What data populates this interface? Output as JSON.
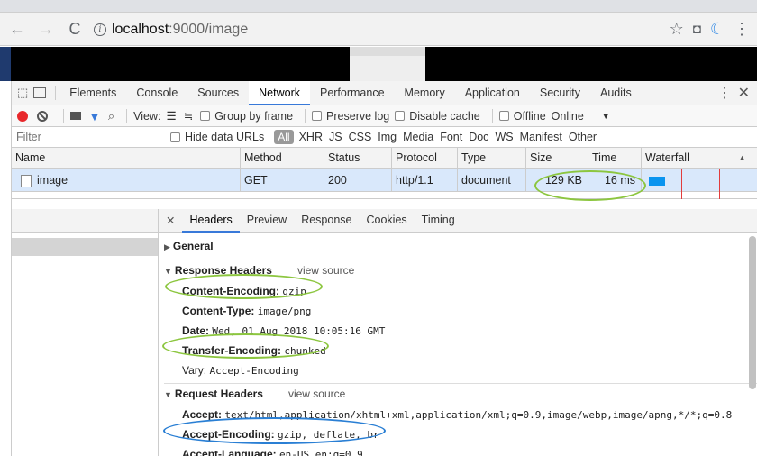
{
  "browser": {
    "url_host": "localhost",
    "url_path": ":9000/image"
  },
  "devtools": {
    "tabs": [
      "Elements",
      "Console",
      "Sources",
      "Network",
      "Performance",
      "Memory",
      "Application",
      "Security",
      "Audits"
    ],
    "toolbar": {
      "view_label": "View:",
      "group_by_frame": "Group by frame",
      "preserve_log": "Preserve log",
      "disable_cache": "Disable cache",
      "offline": "Offline",
      "throttle": "Online"
    },
    "filter": {
      "placeholder": "Filter",
      "hide_data_urls": "Hide data URLs",
      "all": "All",
      "types": [
        "XHR",
        "JS",
        "CSS",
        "Img",
        "Media",
        "Font",
        "Doc",
        "WS",
        "Manifest",
        "Other"
      ]
    },
    "columns": [
      "Name",
      "Method",
      "Status",
      "Protocol",
      "Type",
      "Size",
      "Time",
      "Waterfall"
    ],
    "request": {
      "name": "image",
      "method": "GET",
      "status": "200",
      "protocol": "http/1.1",
      "type": "document",
      "size": "129 KB",
      "time": "16 ms"
    },
    "detail_tabs": [
      "Headers",
      "Preview",
      "Response",
      "Cookies",
      "Timing"
    ],
    "general_label": "General",
    "response_headers_label": "Response Headers",
    "request_headers_label": "Request Headers",
    "view_source": "view source",
    "response_headers": [
      {
        "key": "Content-Encoding:",
        "value": "gzip"
      },
      {
        "key": "Content-Type:",
        "value": "image/png"
      },
      {
        "key": "Date:",
        "value": "Wed, 01 Aug 2018 10:05:16 GMT"
      },
      {
        "key": "Transfer-Encoding:",
        "value": "chunked"
      },
      {
        "key": "Vary:",
        "value": "Accept-Encoding"
      }
    ],
    "request_headers": [
      {
        "key": "Accept:",
        "value": "text/html,application/xhtml+xml,application/xml;q=0.9,image/webp,image/apng,*/*;q=0.8"
      },
      {
        "key": "Accept-Encoding:",
        "value": "gzip, deflate, br"
      },
      {
        "key": "Accept-Language:",
        "value": "en-US,en;q=0.9"
      }
    ]
  },
  "colors": {
    "highlight_green": "#8cc63f",
    "highlight_blue": "#2a7fd4",
    "record_red": "#e8272b",
    "selected_row": "#d9e8fb"
  }
}
